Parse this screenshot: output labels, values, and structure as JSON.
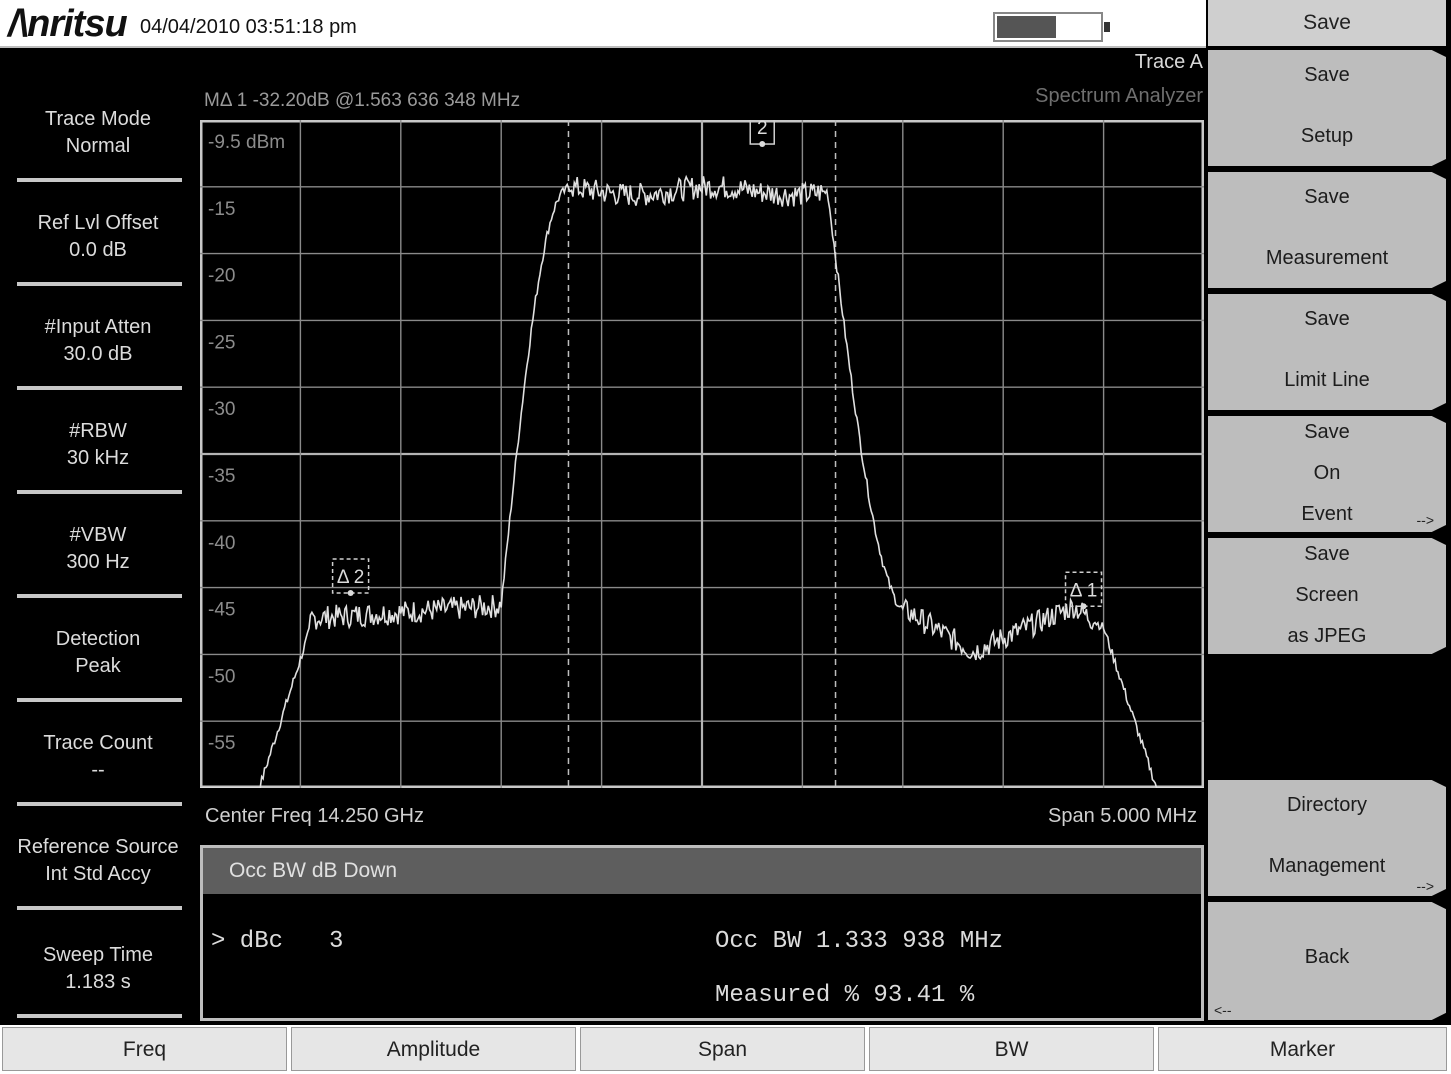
{
  "header": {
    "logo": "/\\nritsu",
    "datetime": "04/04/2010 03:51:18 pm",
    "battery_level_percent": 58
  },
  "left_panel": {
    "params": [
      {
        "label": "Trace Mode",
        "value": "Normal"
      },
      {
        "label": "Ref Lvl Offset",
        "value": "0.0 dB"
      },
      {
        "label": "#Input Atten",
        "value": "30.0 dB"
      },
      {
        "label": "#RBW",
        "value": "30 kHz"
      },
      {
        "label": "#VBW",
        "value": "300 Hz"
      },
      {
        "label": "Detection",
        "value": "Peak"
      },
      {
        "label": "Trace Count",
        "value": "--"
      },
      {
        "label": "Reference Source",
        "value": "Int Std Accy"
      },
      {
        "label": "Sweep Time",
        "value": "1.183 s"
      }
    ]
  },
  "graph": {
    "trace": "Trace A",
    "mode": "Spectrum Analyzer",
    "marker_readout": "MΔ 1 -32.20dB @1.563 636 348 MHz",
    "center_freq": "Center Freq 14.250 GHz",
    "span": "Span 5.000 MHz"
  },
  "chart_data": {
    "type": "line",
    "ylim": [
      -59.5,
      -9.5
    ],
    "y_ticks": [
      "-9.5 dBm",
      "-15",
      "-20",
      "-25",
      "-30",
      "-35",
      "-40",
      "-45",
      "-50",
      "-55"
    ],
    "grid": true,
    "x_divisions": 10,
    "trace_color": "#e0e0e0",
    "markers": [
      {
        "label": "2",
        "x": 0.56,
        "y": -11.3
      },
      {
        "label": "Δ 2",
        "x": 0.15,
        "y": -44.9
      },
      {
        "label": "Δ 1",
        "x": 0.88,
        "y": -45.9
      }
    ],
    "occ_bw_lines_x": [
      0.367,
      0.633
    ]
  },
  "occ_panel": {
    "title": "Occ BW dB Down",
    "dbc_label": "> dBc",
    "dbc_value": "3",
    "occ_bw": "Occ BW 1.333 938 MHz",
    "measured": "Measured % 93.41 %"
  },
  "softkeys": {
    "title": "Save",
    "keys": [
      {
        "lines": [
          "Save",
          "Setup"
        ],
        "arrow": ""
      },
      {
        "lines": [
          "Save",
          "Measurement"
        ],
        "arrow": ""
      },
      {
        "lines": [
          "Save",
          "Limit Line"
        ],
        "arrow": ""
      },
      {
        "lines": [
          "Save",
          "On",
          "Event"
        ],
        "arrow": "-->"
      },
      {
        "lines": [
          "Save",
          "Screen",
          "as JPEG"
        ],
        "arrow": ""
      },
      {
        "lines": [
          "Directory",
          "Management"
        ],
        "arrow": "-->"
      },
      {
        "lines": [
          "Back"
        ],
        "arrow": "<--"
      }
    ]
  },
  "bottom_tabs": [
    "Freq",
    "Amplitude",
    "Span",
    "BW",
    "Marker"
  ]
}
